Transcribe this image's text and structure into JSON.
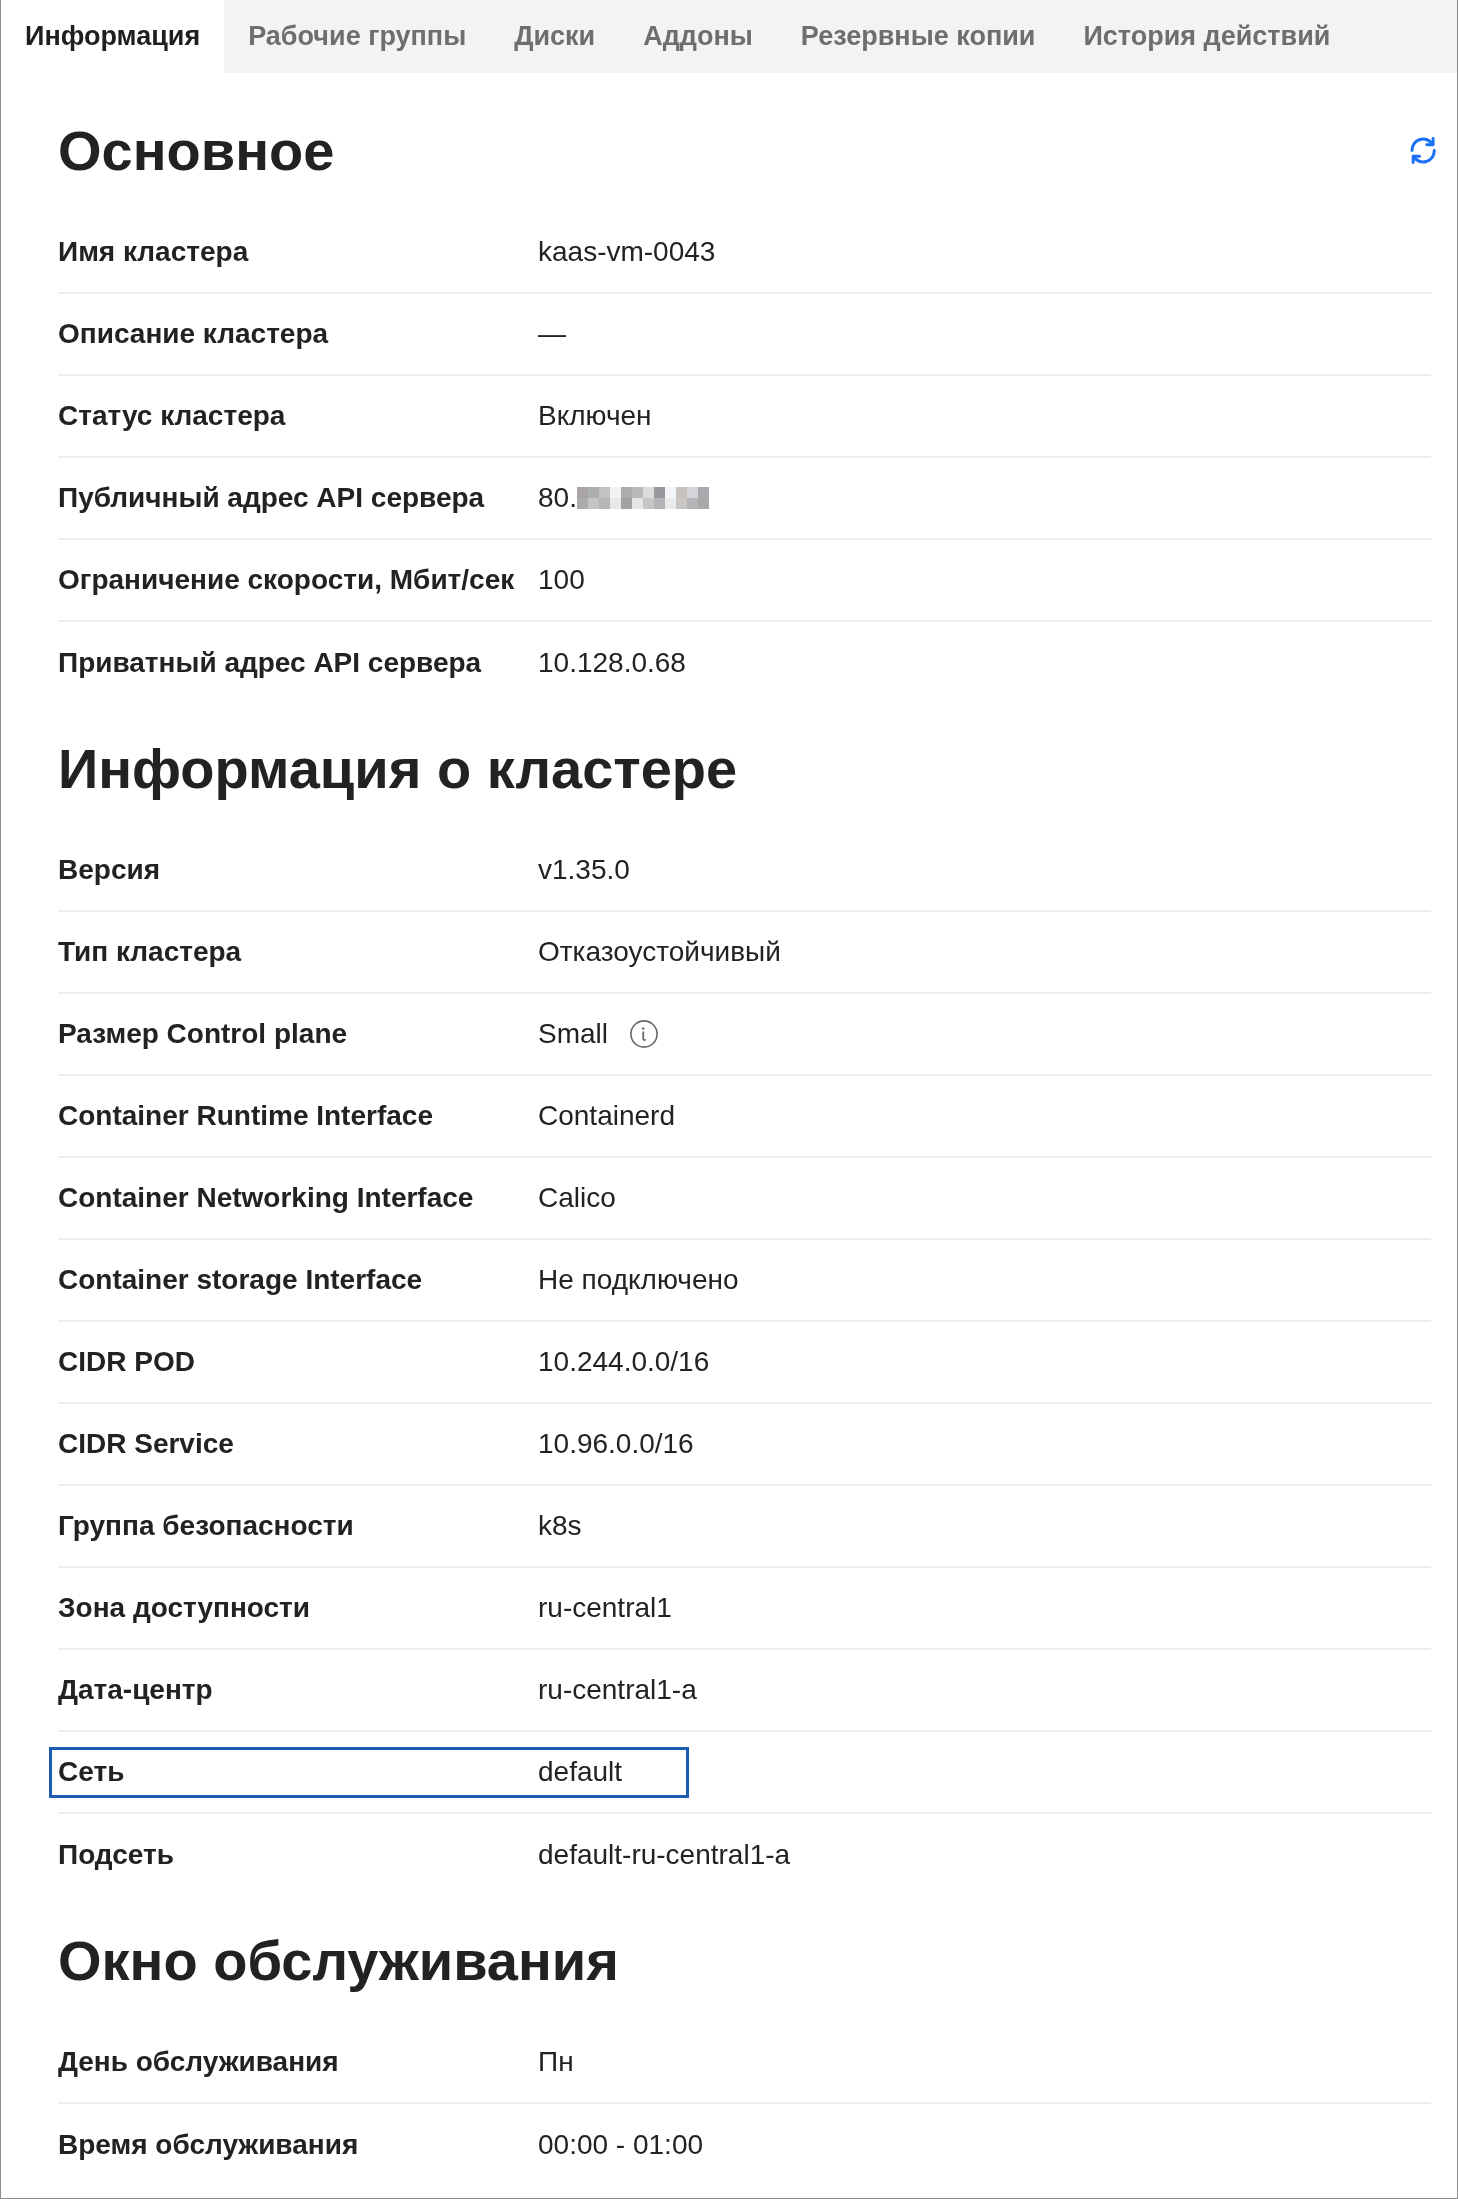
{
  "tabs": [
    {
      "label": "Информация",
      "selected": true
    },
    {
      "label": "Рабочие группы",
      "selected": false
    },
    {
      "label": "Диски",
      "selected": false
    },
    {
      "label": "Аддоны",
      "selected": false
    },
    {
      "label": "Резервные копии",
      "selected": false
    },
    {
      "label": "История действий",
      "selected": false
    }
  ],
  "sections": [
    {
      "title": "Основное",
      "refresh": true,
      "rows": [
        {
          "label": "Имя кластера",
          "value": "kaas-vm-0043",
          "focused": false
        },
        {
          "label": "Описание кластера",
          "value": "—",
          "focused": false
        },
        {
          "label": "Статус кластера",
          "value": "Включен",
          "focused": false
        },
        {
          "label": "Публичный адрес API сервера",
          "value": "80.",
          "redacted": true,
          "focused": false
        },
        {
          "label": "Ограничение скорости, Мбит/сек",
          "value": "100",
          "focused": false
        },
        {
          "label": "Приватный адрес API сервера",
          "value": "10.128.0.68",
          "focused": false
        }
      ]
    },
    {
      "title": "Информация о кластере",
      "rows": [
        {
          "label": "Версия",
          "value": "v1.35.0",
          "focused": false
        },
        {
          "label": "Тип кластера",
          "value": "Отказоустойчивый",
          "focused": false
        },
        {
          "label": "Размер Control plane",
          "value": "Small",
          "info_icon": true,
          "focused": false
        },
        {
          "label": "Container Runtime Interface",
          "value": "Containerd",
          "focused": false
        },
        {
          "label": "Container Networking Interface",
          "value": "Calico",
          "focused": false
        },
        {
          "label": "Container storage Interface",
          "value": "Не подключено",
          "focused": false
        },
        {
          "label": "CIDR POD",
          "value": "10.244.0.0/16",
          "focused": false
        },
        {
          "label": "CIDR Service",
          "value": "10.96.0.0/16",
          "focused": false
        },
        {
          "label": "Группа безопасности",
          "value": "k8s",
          "focused": false
        },
        {
          "label": "Зона доступности",
          "value": "ru-central1",
          "focused": false
        },
        {
          "label": "Дата-центр",
          "value": "ru-central1-a",
          "focused": false
        },
        {
          "label": "Сеть",
          "value": "default",
          "focused": true
        },
        {
          "label": "Подсеть",
          "value": "default-ru-central1-a",
          "focused": false
        }
      ]
    },
    {
      "title": "Окно обслуживания",
      "rows": [
        {
          "label": "День обслуживания",
          "value": "Пн",
          "focused": false
        },
        {
          "label": "Время обслуживания",
          "value": "00:00 - 01:00",
          "focused": false
        }
      ]
    }
  ]
}
